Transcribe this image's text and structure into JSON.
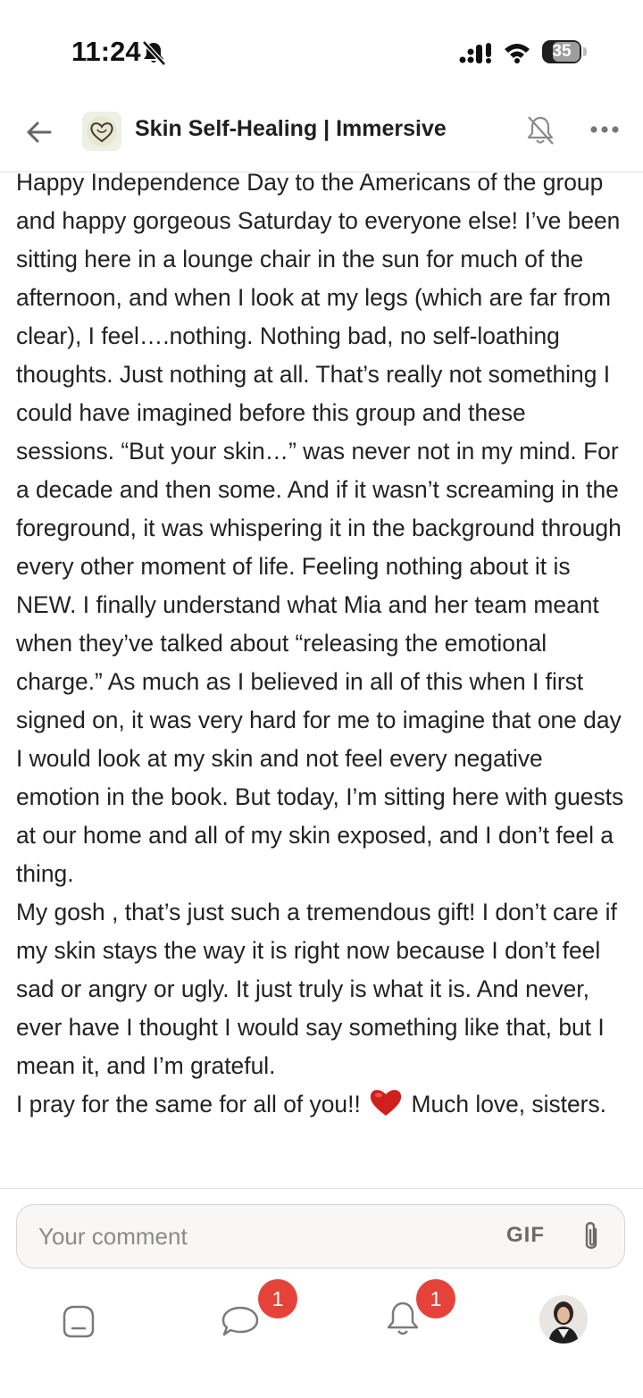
{
  "status_bar": {
    "time": "11:24",
    "battery": "35",
    "icons": [
      "mute-bell-icon",
      "cellular-signal-icon",
      "wifi-icon",
      "battery-icon"
    ]
  },
  "header": {
    "title": "Skin Self-Healing | Immersive",
    "icons": [
      "back-arrow-icon",
      "group-heart-logo",
      "bell-off-icon",
      "more-dots-icon"
    ]
  },
  "post": {
    "paragraphs": [
      "Happy Independence Day to the Americans of the group and happy gorgeous Saturday to everyone else! I’ve been sitting here in a lounge chair in the sun for much of the afternoon, and when I look at my legs (which are far from clear), I feel….nothing. Nothing bad, no self-loathing thoughts. Just nothing at all. That’s really not something I could have imagined before this group and these sessions. “But your skin…” was never not in my mind. For a decade and then some. And if it wasn’t screaming in the foreground, it was whispering it in the background through every other moment of life. Feeling nothing about it is NEW. I finally understand what Mia and her team meant when they’ve talked about “releasing the emotional charge.” As much as I believed in all of this when I first signed on, it was very hard for me to imagine that one day I would look at my skin and not feel every negative emotion in the book. But today, I’m sitting here with guests at our home and all of my skin exposed, and I don’t feel a thing.",
      "My gosh , that’s just such a tremendous gift! I don’t care if my skin stays the way it is right now because I don’t feel sad or angry or ugly. It just truly is what it is. And never, ever have I thought I would say something like that, but I mean it, and I’m grateful.",
      "I pray for the same for all of you!!",
      "Much love, sisters."
    ],
    "emoji": "red-heart-icon"
  },
  "comment": {
    "placeholder": "Your comment",
    "gif_label": "GIF",
    "attach_icon": "paperclip-icon"
  },
  "nav": {
    "chat_badge": "1",
    "notifications_badge": "1",
    "icons": [
      "home-icon",
      "chat-icon",
      "bell-icon",
      "profile-avatar"
    ]
  },
  "colors": {
    "badge": "#e5433a",
    "text": "#222222",
    "heart": "#d0201e"
  }
}
